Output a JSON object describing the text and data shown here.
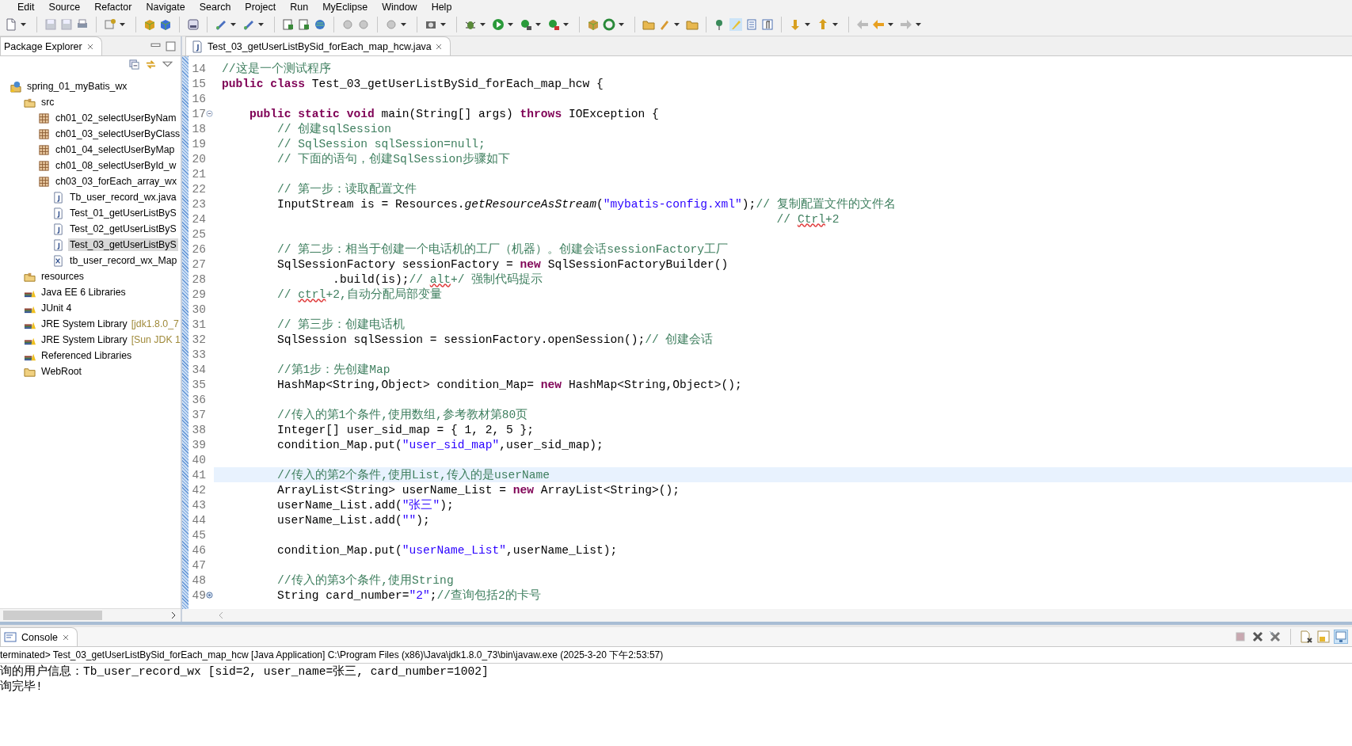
{
  "menu_bar": [
    "Edit",
    "Source",
    "Refactor",
    "Navigate",
    "Search",
    "Project",
    "Run",
    "MyEclipse",
    "Window",
    "Help"
  ],
  "package_explorer": {
    "title": "Package Explorer",
    "tree": [
      {
        "label": "spring_01_myBatis_wx",
        "kind": "project",
        "selected": false,
        "children": [
          {
            "label": "src",
            "kind": "source_folder",
            "selected": false,
            "children": [
              {
                "label": "ch01_02_selectUserByNam",
                "kind": "package",
                "selected": false
              },
              {
                "label": "ch01_03_selectUserByClass",
                "kind": "package",
                "selected": false
              },
              {
                "label": "ch01_04_selectUserByMap",
                "kind": "package",
                "selected": false
              },
              {
                "label": "ch01_08_selectUserById_w",
                "kind": "package",
                "selected": false
              },
              {
                "label": "ch03_03_forEach_array_wx",
                "kind": "package",
                "selected": false,
                "children": [
                  {
                    "label": "Tb_user_record_wx.java",
                    "kind": "java",
                    "selected": false
                  },
                  {
                    "label": "Test_01_getUserListByS",
                    "kind": "java",
                    "selected": false
                  },
                  {
                    "label": "Test_02_getUserListByS",
                    "kind": "java",
                    "selected": false
                  },
                  {
                    "label": "Test_03_getUserListByS",
                    "kind": "java",
                    "selected": true
                  },
                  {
                    "label": "tb_user_record_wx_Map",
                    "kind": "xml",
                    "selected": false
                  }
                ]
              }
            ]
          },
          {
            "label": "resources",
            "kind": "source_folder",
            "selected": false
          },
          {
            "label": "Java EE 6 Libraries",
            "kind": "library",
            "selected": false
          },
          {
            "label": "JUnit 4",
            "kind": "library",
            "selected": false
          },
          {
            "label": "JRE System Library",
            "decoration": "[jdk1.8.0_7",
            "kind": "library",
            "selected": false
          },
          {
            "label": "JRE System Library",
            "decoration": "[Sun JDK 1",
            "kind": "library",
            "selected": false
          },
          {
            "label": "Referenced Libraries",
            "kind": "library",
            "selected": false
          },
          {
            "label": "WebRoot",
            "kind": "folder",
            "selected": false
          }
        ]
      }
    ]
  },
  "editor": {
    "tab": "Test_03_getUserListBySid_forEach_map_hcw.java",
    "lines": [
      {
        "number": "14",
        "current": false,
        "segments": [
          {
            "kind": "comment",
            "text": "//这是一个测试程序"
          }
        ]
      },
      {
        "number": "15",
        "current": false,
        "segments": [
          {
            "kind": "keyword",
            "text": "public class"
          },
          {
            "kind": "code",
            "text": " Test_03_getUserListBySid_forEach_map_hcw {"
          }
        ]
      },
      {
        "number": "16",
        "current": false
      },
      {
        "number": "17",
        "current": false,
        "kind": "fold",
        "segments": [
          {
            "kind": "keyword",
            "text": "    public static void"
          },
          {
            "kind": "code",
            "text": " main(String[] args) "
          },
          {
            "kind": "keyword",
            "text": "throws"
          },
          {
            "kind": "code",
            "text": " IOException {"
          }
        ]
      },
      {
        "number": "18",
        "current": false,
        "segments": [
          {
            "kind": "comment",
            "text": "        // 创建sqlSession"
          }
        ]
      },
      {
        "number": "19",
        "current": false,
        "segments": [
          {
            "kind": "comment",
            "text": "        // SqlSession sqlSession=null;"
          }
        ]
      },
      {
        "number": "20",
        "current": false,
        "segments": [
          {
            "kind": "comment",
            "text": "        // 下面的语句，创建SqlSession步骤如下"
          }
        ]
      },
      {
        "number": "21",
        "current": false
      },
      {
        "number": "22",
        "current": false,
        "segments": [
          {
            "kind": "comment",
            "text": "        // 第一步：读取配置文件"
          }
        ]
      },
      {
        "number": "23",
        "current": false,
        "segments": [
          {
            "kind": "code",
            "text": "        InputStream is = Resources."
          },
          {
            "kind": "static_call",
            "text": "getResourceAsStream"
          },
          {
            "kind": "code",
            "text": "("
          },
          {
            "kind": "string",
            "text": "\"mybatis-config.xml\""
          },
          {
            "kind": "code",
            "text": ");"
          },
          {
            "kind": "comment",
            "text": "// 复制配置文件的文件名"
          }
        ]
      },
      {
        "number": "24",
        "current": false,
        "segments": [
          {
            "kind": "comment",
            "text": "                                                                                // "
          },
          {
            "kind": "misspelled",
            "text": "Ctrl"
          },
          {
            "kind": "comment",
            "text": "+2"
          }
        ]
      },
      {
        "number": "25",
        "current": false
      },
      {
        "number": "26",
        "current": false,
        "segments": [
          {
            "kind": "comment",
            "text": "        // 第二步：相当于创建一个电话机的工厂（机器）。创建会话sessionFactory工厂"
          }
        ]
      },
      {
        "number": "27",
        "current": false,
        "segments": [
          {
            "kind": "code",
            "text": "        SqlSessionFactory sessionFactory = "
          },
          {
            "kind": "keyword",
            "text": "new"
          },
          {
            "kind": "code",
            "text": " SqlSessionFactoryBuilder()"
          }
        ]
      },
      {
        "number": "28",
        "current": false,
        "segments": [
          {
            "kind": "code",
            "text": "                .build(is);"
          },
          {
            "kind": "comment",
            "text": "// "
          },
          {
            "kind": "misspelled",
            "text": "alt"
          },
          {
            "kind": "comment",
            "text": "+/ 强制代码提示"
          }
        ]
      },
      {
        "number": "29",
        "current": false,
        "segments": [
          {
            "kind": "comment",
            "text": "        // "
          },
          {
            "kind": "misspelled",
            "text": "ctrl"
          },
          {
            "kind": "comment",
            "text": "+2,自动分配局部变量"
          }
        ]
      },
      {
        "number": "30",
        "current": false
      },
      {
        "number": "31",
        "current": false,
        "segments": [
          {
            "kind": "comment",
            "text": "        // 第三步：创建电话机"
          }
        ]
      },
      {
        "number": "32",
        "current": false,
        "segments": [
          {
            "kind": "code",
            "text": "        SqlSession sqlSession = sessionFactory.openSession();"
          },
          {
            "kind": "comment",
            "text": "// 创建会话"
          }
        ]
      },
      {
        "number": "33",
        "current": false
      },
      {
        "number": "34",
        "current": false,
        "segments": [
          {
            "kind": "comment",
            "text": "        //第1步：先创建Map"
          }
        ]
      },
      {
        "number": "35",
        "current": false,
        "segments": [
          {
            "kind": "code",
            "text": "        HashMap<String,Object> condition_Map= "
          },
          {
            "kind": "keyword",
            "text": "new"
          },
          {
            "kind": "code",
            "text": " HashMap<String,Object>();"
          }
        ]
      },
      {
        "number": "36",
        "current": false
      },
      {
        "number": "37",
        "current": false,
        "segments": [
          {
            "kind": "comment",
            "text": "        //传入的第1个条件,使用数组,参考教材第80页"
          }
        ]
      },
      {
        "number": "38",
        "current": false,
        "segments": [
          {
            "kind": "code",
            "text": "        Integer[] user_sid_map = { 1, 2, 5 };"
          }
        ]
      },
      {
        "number": "39",
        "current": false,
        "segments": [
          {
            "kind": "code",
            "text": "        condition_Map.put("
          },
          {
            "kind": "string",
            "text": "\"user_sid_map\""
          },
          {
            "kind": "code",
            "text": ",user_sid_map);"
          }
        ]
      },
      {
        "number": "40",
        "current": false
      },
      {
        "number": "41",
        "current": true,
        "segments": [
          {
            "kind": "comment",
            "text": "        //传入的第2个条件,使用List,传入的是userName"
          }
        ]
      },
      {
        "number": "42",
        "current": false,
        "segments": [
          {
            "kind": "code",
            "text": "        ArrayList<String> userName_List = "
          },
          {
            "kind": "keyword",
            "text": "new"
          },
          {
            "kind": "code",
            "text": " ArrayList<String>();"
          }
        ]
      },
      {
        "number": "43",
        "current": false,
        "segments": [
          {
            "kind": "code",
            "text": "        userName_List.add("
          },
          {
            "kind": "string",
            "text": "\"张三\""
          },
          {
            "kind": "code",
            "text": ");"
          }
        ]
      },
      {
        "number": "44",
        "current": false,
        "segments": [
          {
            "kind": "code",
            "text": "        userName_List.add("
          },
          {
            "kind": "string",
            "text": "\"\""
          },
          {
            "kind": "code",
            "text": ");"
          }
        ]
      },
      {
        "number": "45",
        "current": false
      },
      {
        "number": "46",
        "current": false,
        "segments": [
          {
            "kind": "code",
            "text": "        condition_Map.put("
          },
          {
            "kind": "string",
            "text": "\"userName_List\""
          },
          {
            "kind": "code",
            "text": ",userName_List);"
          }
        ]
      },
      {
        "number": "47",
        "current": false
      },
      {
        "number": "48",
        "current": false,
        "segments": [
          {
            "kind": "comment",
            "text": "        //传入的第3个条件,使用String"
          }
        ]
      },
      {
        "number": "49",
        "current": false,
        "kind": "override",
        "segments": [
          {
            "kind": "code",
            "text": "        String card_number="
          },
          {
            "kind": "string",
            "text": "\"2\""
          },
          {
            "kind": "code",
            "text": ";"
          },
          {
            "kind": "comment",
            "text": "//查询包括2的卡号"
          }
        ]
      }
    ]
  },
  "console": {
    "title": "Console",
    "status": "terminated> Test_03_getUserListBySid_forEach_map_hcw [Java Application] C:\\Program Files (x86)\\Java\\jdk1.8.0_73\\bin\\javaw.exe (2025-3-20 下午2:53:57)",
    "output": [
      "询的用户信息：Tb_user_record_wx [sid=2, user_name=张三, card_number=1002]",
      "询完毕!"
    ]
  }
}
